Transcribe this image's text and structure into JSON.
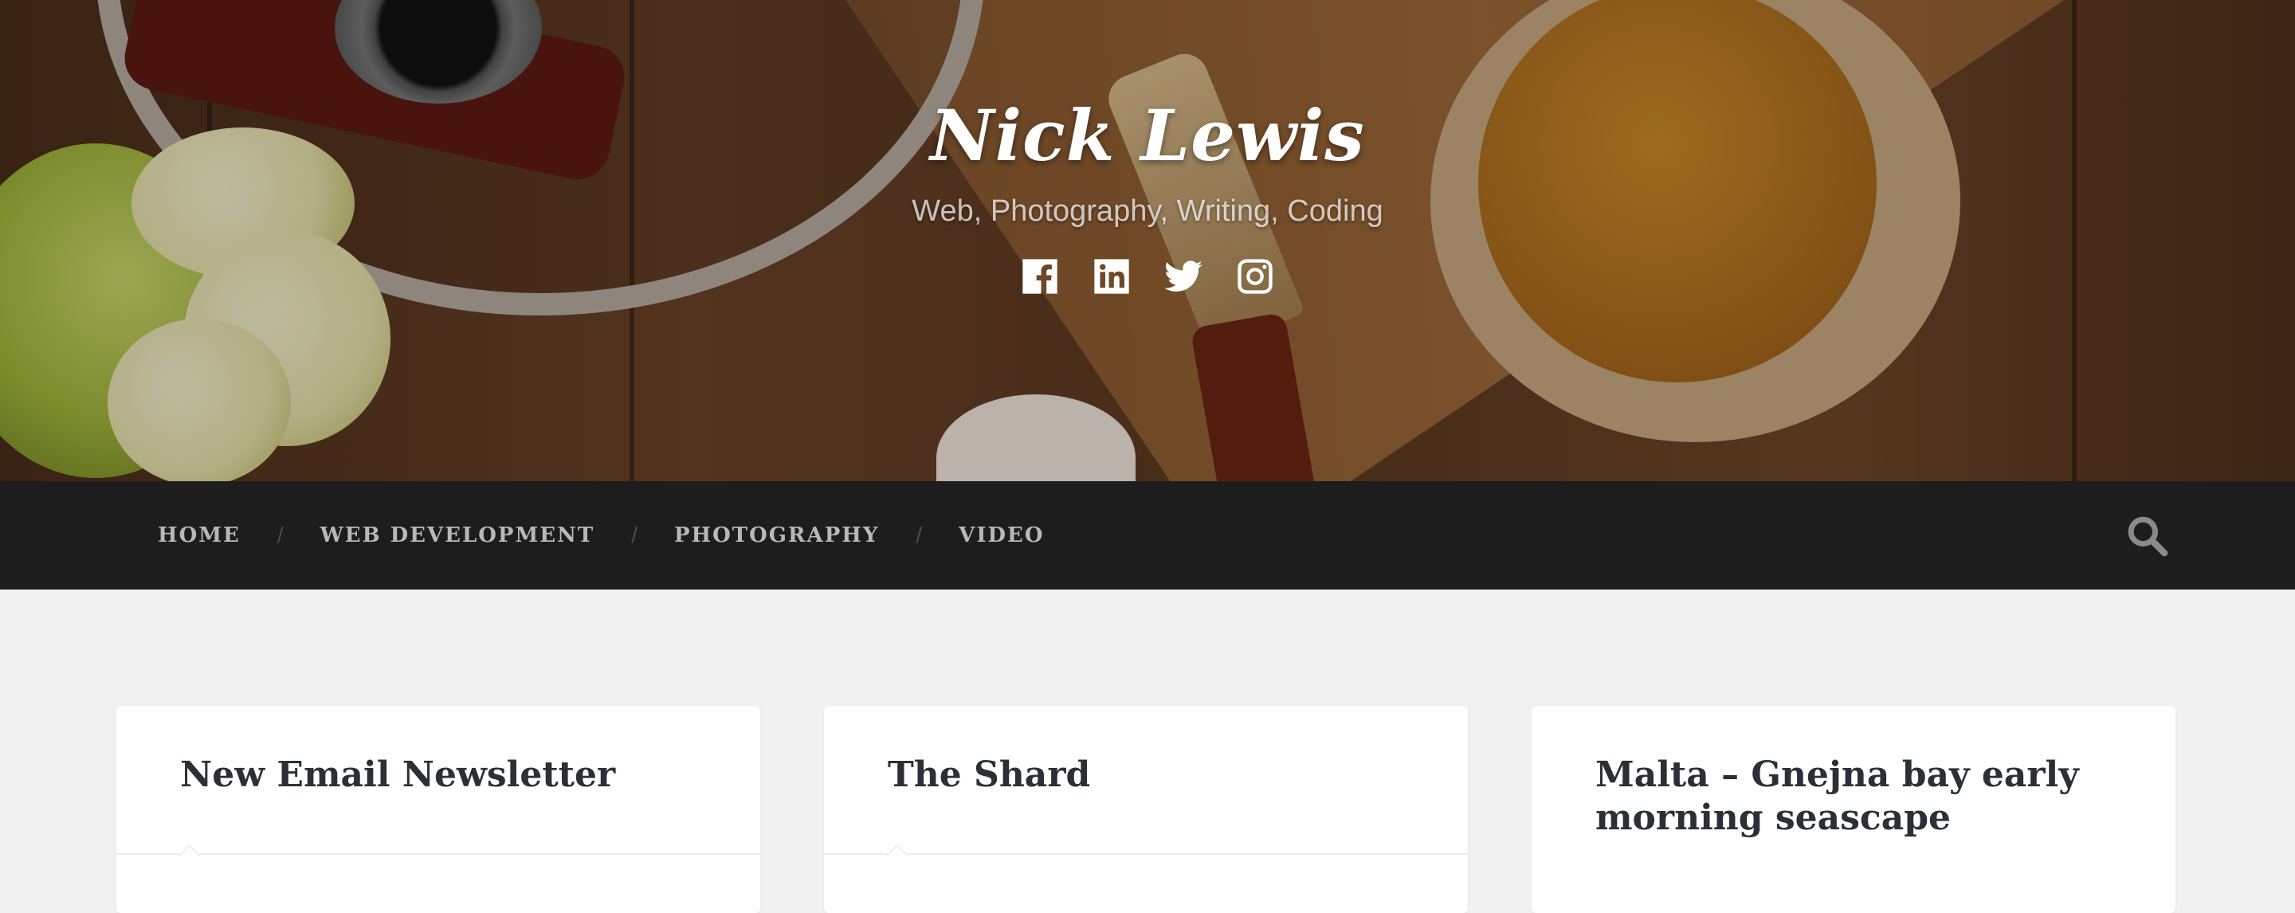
{
  "site": {
    "title": "Nick Lewis",
    "tagline": "Web, Photography, Writing, Coding"
  },
  "social": [
    {
      "name": "facebook",
      "icon": "facebook-icon"
    },
    {
      "name": "linkedin",
      "icon": "linkedin-icon"
    },
    {
      "name": "twitter",
      "icon": "twitter-icon"
    },
    {
      "name": "instagram",
      "icon": "instagram-icon"
    }
  ],
  "nav": {
    "items": [
      {
        "label": "HOME"
      },
      {
        "label": "WEB DEVELOPMENT"
      },
      {
        "label": "PHOTOGRAPHY"
      },
      {
        "label": "VIDEO"
      }
    ],
    "separator": "/",
    "search_icon": "search-icon"
  },
  "posts": [
    {
      "title": "New Email Newsletter"
    },
    {
      "title": "The Shard"
    },
    {
      "title": "Malta – Gnejna bay early morning seascape"
    }
  ],
  "colors": {
    "nav_background": "#1d1d1d",
    "nav_text": "#b8b8b8",
    "page_background": "#f1f1f1",
    "card_background": "#ffffff",
    "title_text": "#2b2f36"
  }
}
